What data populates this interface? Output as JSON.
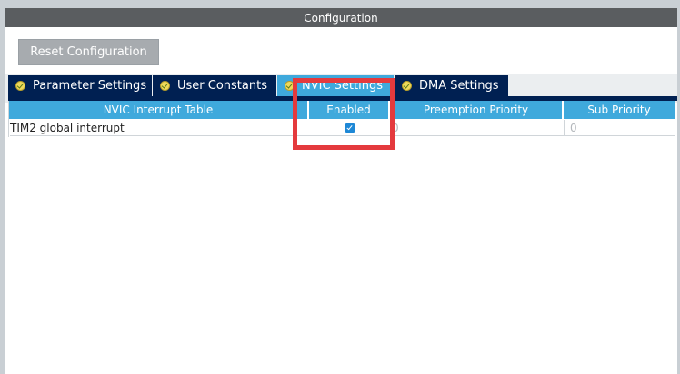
{
  "title": "Configuration",
  "reset_button": "Reset Configuration",
  "tabs": [
    {
      "label": "Parameter Settings",
      "icon": "check-circle-icon"
    },
    {
      "label": "User Constants",
      "icon": "check-circle-icon"
    },
    {
      "label": "NVIC Settings",
      "icon": "check-circle-icon",
      "active": true
    },
    {
      "label": "DMA Settings",
      "icon": "check-circle-icon"
    }
  ],
  "table": {
    "headers": [
      "NVIC Interrupt Table",
      "Enabled",
      "Preemption Priority",
      "Sub Priority"
    ],
    "rows": [
      {
        "name": "TIM2 global interrupt",
        "enabled": true,
        "preemption_priority": "0",
        "sub_priority": "0"
      }
    ]
  },
  "colors": {
    "title_bar": "#5a5d60",
    "tab_inactive": "#002052",
    "tab_active": "#3fa9dc",
    "header": "#3fa9dc",
    "checkbox": "#1e88d6",
    "highlight": "#e43a3d"
  }
}
